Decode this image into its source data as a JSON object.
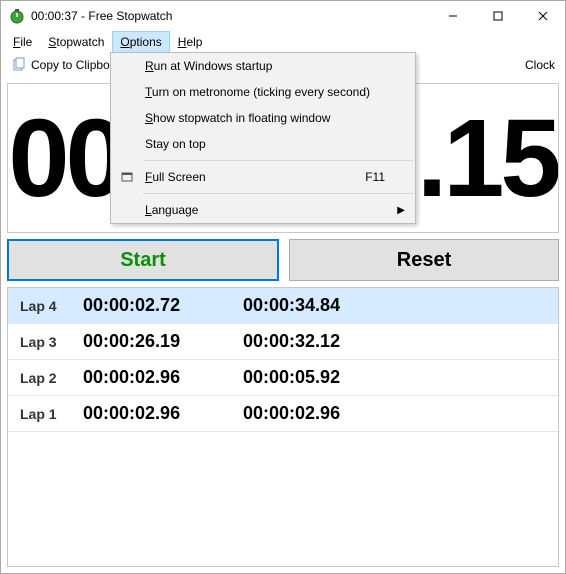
{
  "titlebar": {
    "title": "00:00:37 - Free Stopwatch"
  },
  "menubar": {
    "file": "File",
    "stopwatch": "Stopwatch",
    "options": "Options",
    "help": "Help"
  },
  "toolbar": {
    "copy_label": "Copy to Clipboard",
    "clock_label": "Clock"
  },
  "time_display": "00:00:37.15",
  "buttons": {
    "start": "Start",
    "reset": "Reset"
  },
  "laps": [
    {
      "label": "Lap 4",
      "split": "00:00:02.72",
      "total": "00:00:34.84",
      "selected": true
    },
    {
      "label": "Lap 3",
      "split": "00:00:26.19",
      "total": "00:00:32.12",
      "selected": false
    },
    {
      "label": "Lap 2",
      "split": "00:00:02.96",
      "total": "00:00:05.92",
      "selected": false
    },
    {
      "label": "Lap 1",
      "split": "00:00:02.96",
      "total": "00:00:02.96",
      "selected": false
    }
  ],
  "options_menu": {
    "run_startup": "Run at Windows startup",
    "metronome": "Turn on metronome (ticking every second)",
    "floating": "Show stopwatch in floating window",
    "stay_top": "Stay on top",
    "fullscreen": "Full Screen",
    "fullscreen_shortcut": "F11",
    "language": "Language"
  }
}
